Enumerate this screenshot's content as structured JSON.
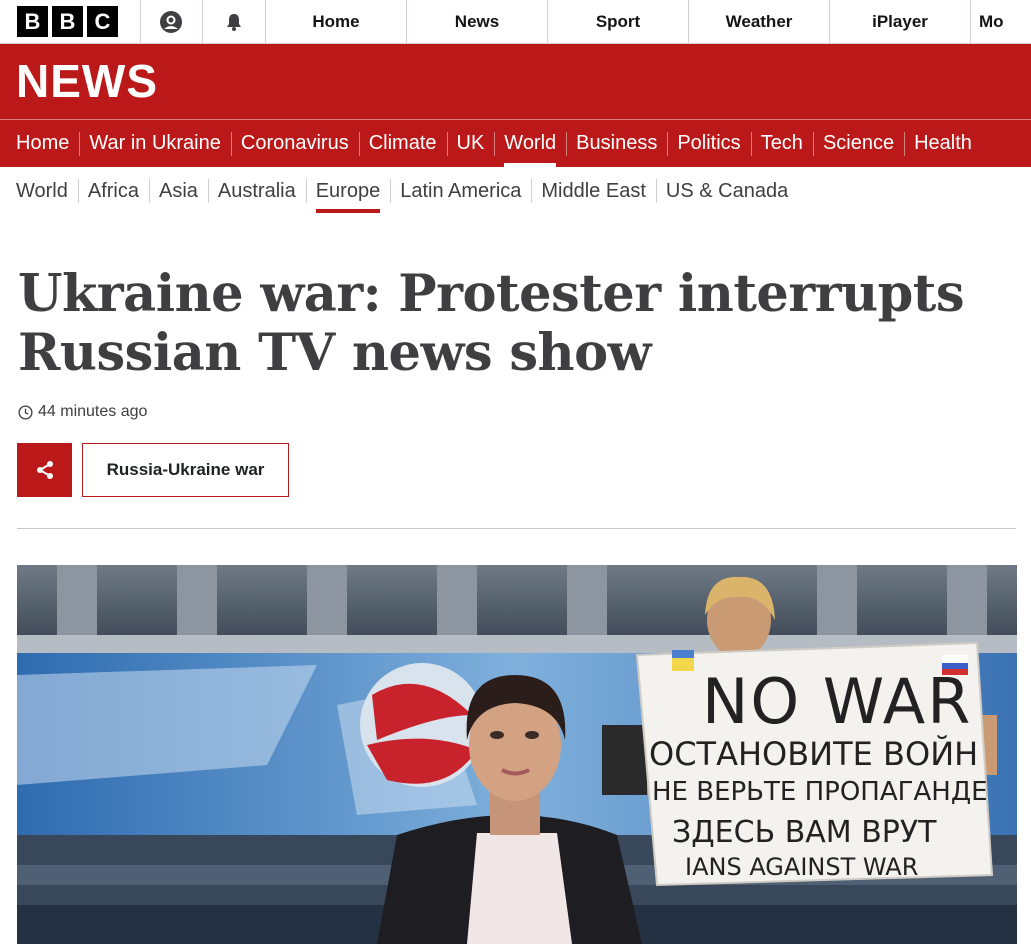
{
  "topbar": {
    "logo_letters": [
      "B",
      "B",
      "C"
    ],
    "icons": [
      "account-icon",
      "notifications-icon"
    ],
    "nav": [
      "Home",
      "News",
      "Sport",
      "Weather",
      "iPlayer",
      "Mo"
    ]
  },
  "banner": {
    "title": "NEWS"
  },
  "primary_nav": {
    "items": [
      "Home",
      "War in Ukraine",
      "Coronavirus",
      "Climate",
      "UK",
      "World",
      "Business",
      "Politics",
      "Tech",
      "Science",
      "Health"
    ],
    "active": "World"
  },
  "secondary_nav": {
    "items": [
      "World",
      "Africa",
      "Asia",
      "Australia",
      "Europe",
      "Latin America",
      "Middle East",
      "US & Canada"
    ],
    "active": "Europe"
  },
  "article": {
    "headline": "Ukraine war: Protester interrupts Russian TV news show",
    "timestamp": "44 minutes ago",
    "topic_label": "Russia-Ukraine war"
  },
  "photo": {
    "sign_lines": [
      "NO WAR",
      "ОСТАНОВИТЕ ВОЙН",
      "НЕ ВЕРЬТЕ ПРОПАГАНДЕ",
      "ЗДЕСЬ ВАМ ВРУТ",
      "IANS AGAINST WAR"
    ]
  },
  "colors": {
    "brand_red": "#bb1919",
    "text": "#3f3f42"
  }
}
